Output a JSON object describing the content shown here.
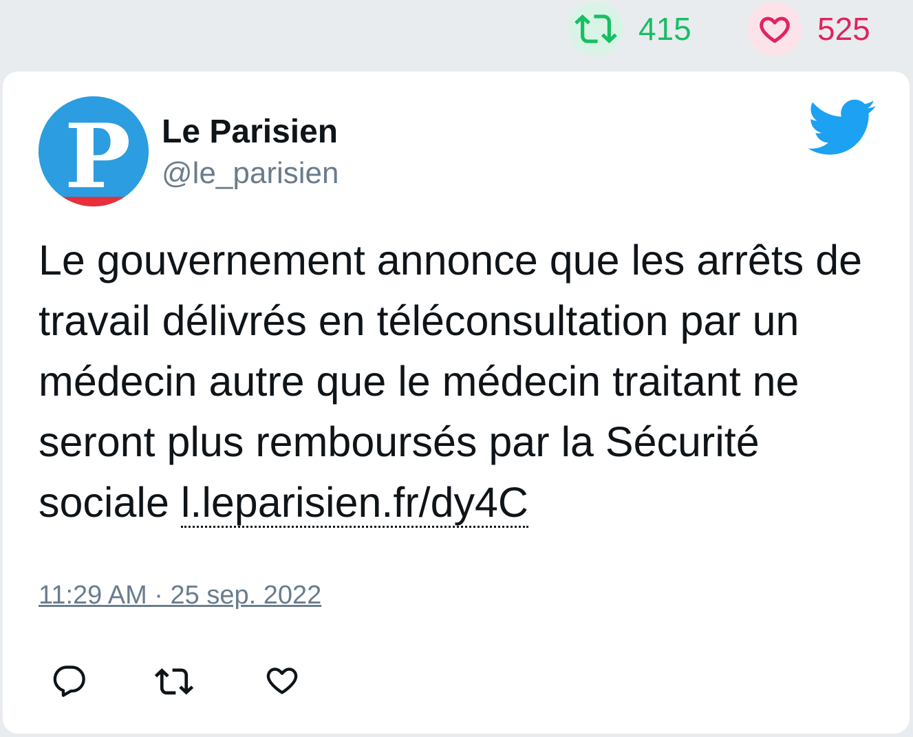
{
  "top_stats": {
    "retweets": "415",
    "likes": "525",
    "retweet_icon": "retweet-icon",
    "like_icon": "heart-icon"
  },
  "tweet": {
    "author_name": "Le Parisien",
    "handle": "@le_parisien",
    "avatar_letter": "P",
    "text": "Le gouvernement annonce que les arrêts de travail délivrés en téléconsultation par un médecin autre que le médecin traitant ne seront plus remboursés par la Sécurité sociale ",
    "link": "l.leparisien.fr/dy4C",
    "timestamp": "11:29 AM · 25 sep. 2022"
  },
  "actions": [
    "reply-icon",
    "retweet-icon",
    "like-icon"
  ],
  "colors": {
    "retweet": "#17bf63",
    "like": "#e0245e",
    "twitter_blue": "#1da1f2",
    "muted": "#6a7c8c"
  }
}
